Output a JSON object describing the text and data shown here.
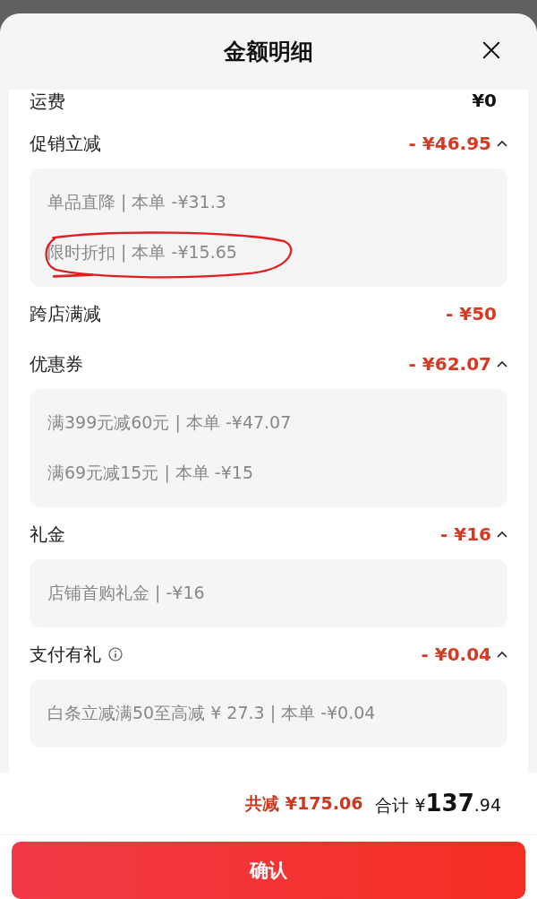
{
  "sheet": {
    "title": "金额明细"
  },
  "rows": [
    {
      "kind": "fee",
      "label": "运费",
      "amount": "¥0"
    },
    {
      "kind": "discount",
      "label": "促销立减",
      "amount": "- ¥46.95",
      "expanded": true,
      "details": [
        {
          "text": "单品直降 | 本单 -¥31.3",
          "highlight": false
        },
        {
          "text": "限时折扣 | 本单 -¥15.65",
          "highlight": true
        }
      ]
    },
    {
      "kind": "discount",
      "label": "跨店满减",
      "amount": "- ¥50"
    },
    {
      "kind": "discount",
      "label": "优惠券",
      "amount": "- ¥62.07",
      "expanded": true,
      "details": [
        {
          "text": "满399元减60元 | 本单 -¥47.07",
          "highlight": false
        },
        {
          "text": "满69元减15元 | 本单 -¥15",
          "highlight": false
        }
      ]
    },
    {
      "kind": "discount",
      "label": "礼金",
      "amount": "- ¥16",
      "expanded": true,
      "details": [
        {
          "text": "店铺首购礼金 | -¥16",
          "highlight": false
        }
      ]
    },
    {
      "kind": "discount",
      "label": "支付有礼",
      "info": true,
      "amount": "- ¥0.04",
      "expanded": true,
      "details": [
        {
          "text": "白条立减满50至高减 ¥ 27.3 | 本单 -¥0.04",
          "highlight": false
        }
      ]
    }
  ],
  "summary": {
    "saved_label": "共减",
    "saved_amount": "¥175.06",
    "total_label": "合计",
    "currency": "¥",
    "total_integer": "137",
    "total_decimal": ".94"
  },
  "confirm_button": "确认"
}
